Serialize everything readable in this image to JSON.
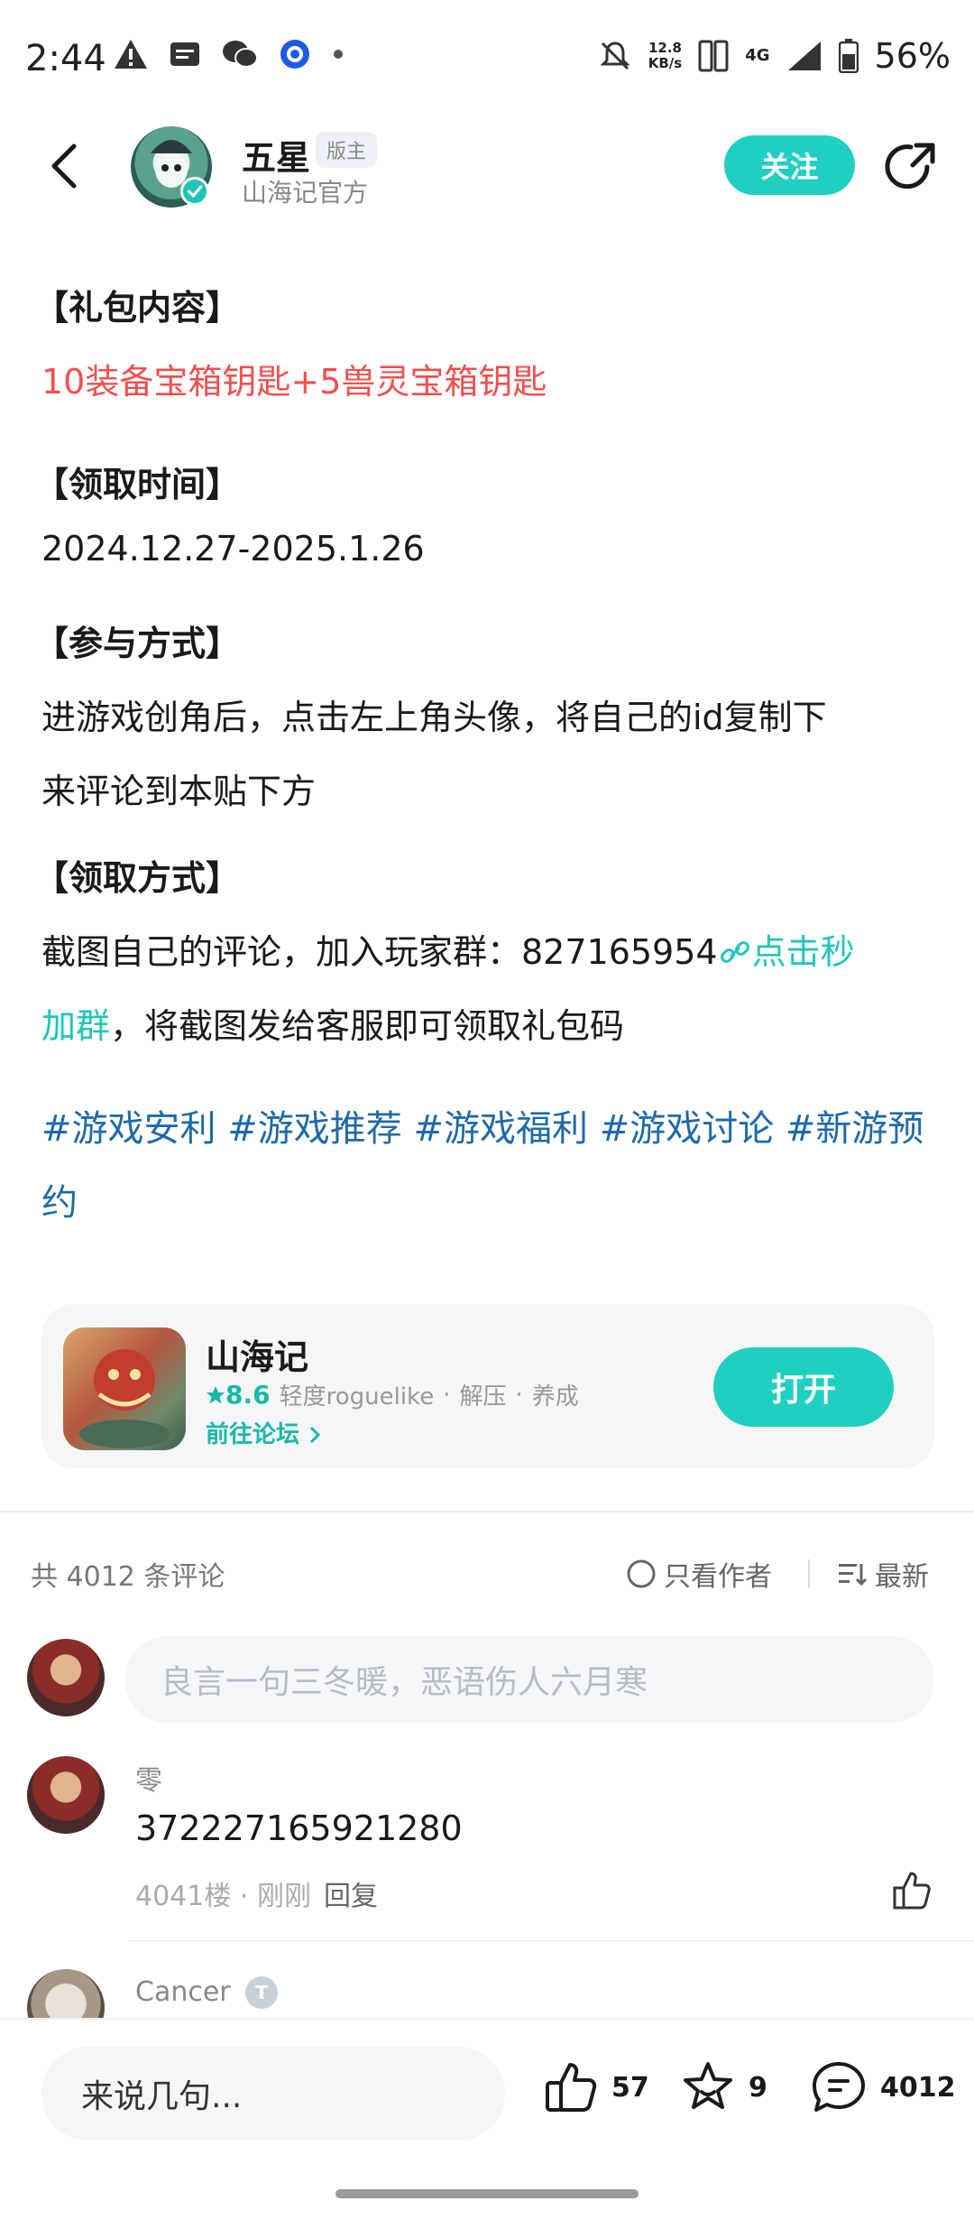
{
  "status_bar": {
    "time": "2:44",
    "speed_value": "12.8",
    "speed_unit": "KB/s",
    "network": "4G",
    "battery": "56%"
  },
  "header": {
    "author_name": "五星",
    "author_badge": "版主",
    "author_subtitle": "山海记官方",
    "follow_label": "关注"
  },
  "post": {
    "sections": [
      {
        "title": "【礼包内容】",
        "lines": [
          "10装备宝箱钥匙+5兽灵宝箱钥匙"
        ]
      },
      {
        "title": "【领取时间】",
        "lines": [
          "2024.12.27-2025.1.26"
        ]
      },
      {
        "title": "【参与方式】",
        "lines": [
          "进游戏创角后，点击左上角头像，将自己的id复制下",
          "来评论到本贴下方"
        ]
      },
      {
        "title": "【领取方式】",
        "line1_prefix": "截图自己的评论，加入玩家群：827165954",
        "line1_link": "点击秒",
        "line2_link": "加群",
        "line2_suffix": "，将截图发给客服即可领取礼包码"
      }
    ],
    "tags_line1": "#游戏安利 #游戏推荐 #游戏福利 #游戏讨论 #新游预",
    "tags_line2": "约"
  },
  "game_card": {
    "name": "山海记",
    "rating": "8.6",
    "tags": [
      "轻度roguelike",
      "解压",
      "养成"
    ],
    "forum_link": "前往论坛",
    "open_label": "打开"
  },
  "comments_header": {
    "count_text": "共 4012 条评论",
    "only_author": "只看作者",
    "sort": "最新"
  },
  "comment_input": {
    "placeholder": "良言一句三冬暖，恶语伤人六月寒"
  },
  "comments": [
    {
      "name": "零",
      "text": "372227165921280",
      "floor": "4041楼 · 刚刚",
      "reply": "回复"
    },
    {
      "name": "Cancer",
      "level": "T"
    }
  ],
  "bottom_bar": {
    "input_placeholder": "来说几句...",
    "likes": "57",
    "favorites": "9",
    "comments": "4012"
  },
  "colors": {
    "accent": "#1fd0c0",
    "red_text": "#f05050",
    "tag_blue": "#1f6aa8"
  }
}
